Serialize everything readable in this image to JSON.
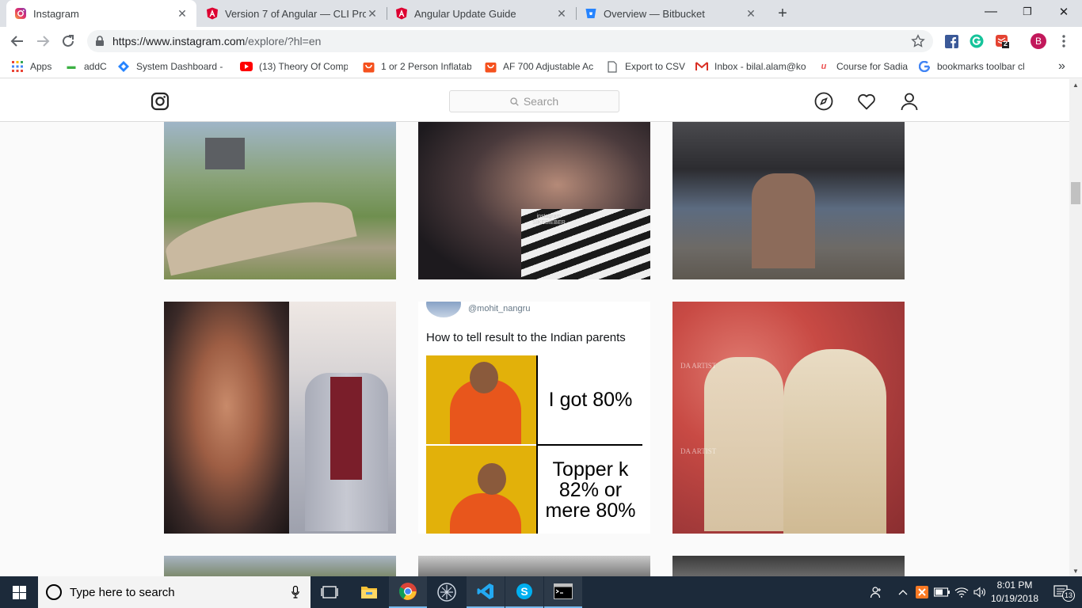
{
  "tabs": [
    {
      "title": "Instagram",
      "icon": "instagram-icon",
      "active": true
    },
    {
      "title": "Version 7 of Angular — CLI Promp",
      "icon": "angular-icon",
      "active": false
    },
    {
      "title": "Angular Update Guide",
      "icon": "angular-icon",
      "active": false
    },
    {
      "title": "Overview — Bitbucket",
      "icon": "bitbucket-icon",
      "active": false
    }
  ],
  "window_controls": {
    "minimize": "—",
    "maximize": "❐",
    "close": "✕"
  },
  "address_bar": {
    "url_host": "https://www.instagram.com",
    "url_path": "/explore/?hl=en"
  },
  "extensions": {
    "todoist_badge": "2",
    "profile_initial": "B"
  },
  "bookmarks": [
    {
      "label": "Apps",
      "icon": "apps-grid-icon"
    },
    {
      "label": "addC",
      "icon": "addc-icon"
    },
    {
      "label": "System Dashboard - ",
      "icon": "jira-icon"
    },
    {
      "label": "(13) Theory Of Comp",
      "icon": "youtube-icon"
    },
    {
      "label": "1 or 2 Person Inflatab",
      "icon": "shopping-icon"
    },
    {
      "label": "AF 700 Adjustable Ac",
      "icon": "shopping-icon"
    },
    {
      "label": "Export to CSV",
      "icon": "page-icon"
    },
    {
      "label": "Inbox - bilal.alam@ko",
      "icon": "gmail-icon"
    },
    {
      "label": "Course for Sadia",
      "icon": "udemy-icon"
    },
    {
      "label": "bookmarks toolbar cl",
      "icon": "google-icon"
    }
  ],
  "bookmarks_overflow": "»",
  "instagram": {
    "search_placeholder": "Search",
    "meme": {
      "handle": "@mohit_nangru",
      "headline": "How to tell result to the Indian parents",
      "top_text": "I got 80%",
      "bottom_text": "Topper k 82% or mere 80%"
    },
    "watermarks": {
      "couple": "instagram SIKEBIEBER",
      "wedding": "DA ARTIST"
    }
  },
  "taskbar": {
    "search_placeholder": "Type here to search",
    "time": "8:01 PM",
    "date": "10/19/2018",
    "notification_count": "13"
  },
  "colors": {
    "tab_strip": "#dee1e6",
    "taskbar": "#1c2a3a",
    "instagram_bg": "#fafafa"
  }
}
